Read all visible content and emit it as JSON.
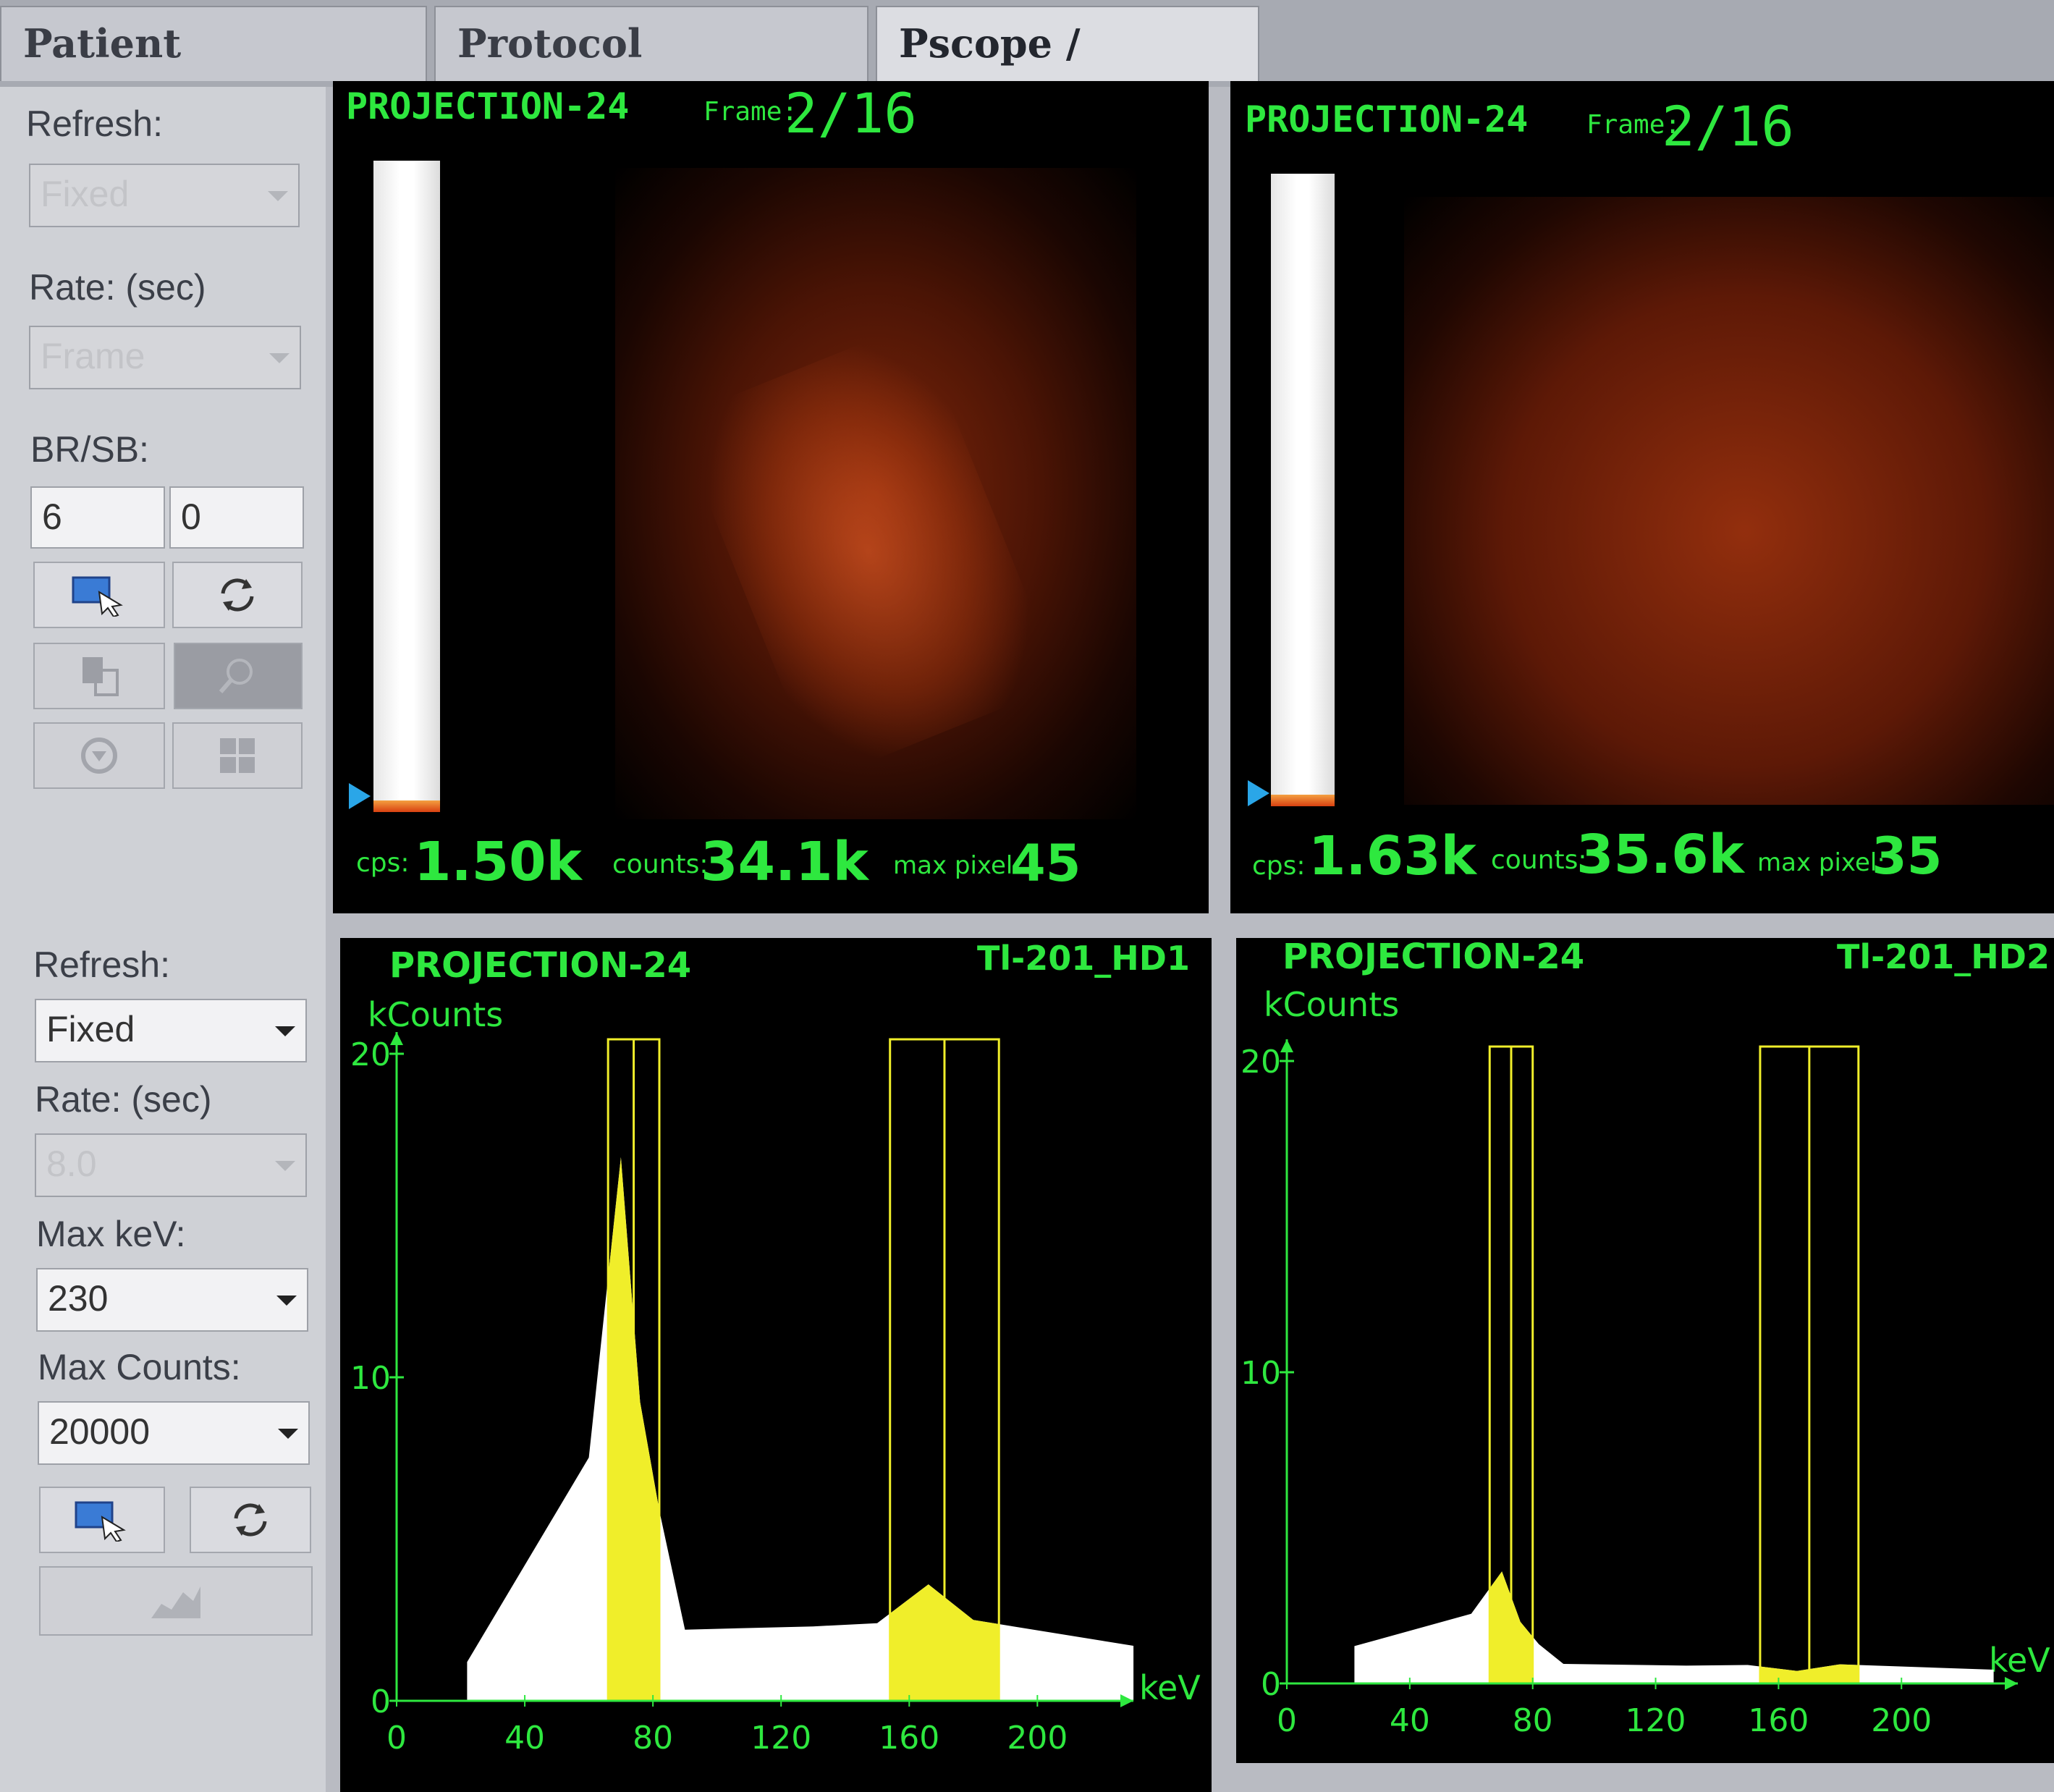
{
  "tabs": [
    {
      "label": "Patient Information"
    },
    {
      "label": "Protocol Information"
    },
    {
      "label": "Pscope / Spectrum"
    }
  ],
  "pscope_controls": {
    "refresh_label": "Refresh:",
    "refresh_value": "Fixed",
    "rate_label": "Rate: (sec)",
    "rate_value": "Frame",
    "brsb_label": "BR/SB:",
    "br_value": "6",
    "sb_value": "0"
  },
  "spectrum_controls": {
    "refresh_label": "Refresh:",
    "refresh_value": "Fixed",
    "rate_label": "Rate: (sec)",
    "rate_value": "8.0",
    "max_kev_label": "Max keV:",
    "max_kev_value": "230",
    "max_counts_label": "Max Counts:",
    "max_counts_value": "20000"
  },
  "pscope": [
    {
      "title": "PROJECTION-24",
      "frame_label": "Frame:",
      "frame": "2/16",
      "cps_label": "cps:",
      "cps": "1.50k",
      "counts_label": "counts:",
      "counts": "34.1k",
      "max_pixel_label": "max pixel:",
      "max_pixel": "45"
    },
    {
      "title": "PROJECTION-24",
      "frame_label": "Frame:",
      "frame": "2/16",
      "cps_label": "cps:",
      "cps": "1.63k",
      "counts_label": "counts:",
      "counts": "35.6k",
      "max_pixel_label": "max pixel:",
      "max_pixel": "35"
    }
  ],
  "spectra": [
    {
      "title": "PROJECTION-24",
      "isotope": "Tl-201_HD1",
      "ylabel": "kCounts",
      "xlabel": "keV",
      "yticks": [
        "20",
        "10",
        "0"
      ],
      "xticks": [
        "0",
        "40",
        "80",
        "120",
        "160",
        "200"
      ],
      "windows_kev": [
        [
          66,
          82
        ],
        [
          154,
          188
        ]
      ],
      "peak_kcounts": 16.8,
      "second_peak_kcounts": 3.6
    },
    {
      "title": "PROJECTION-24",
      "isotope": "Tl-201_HD2",
      "ylabel": "kCounts",
      "xlabel": "keV",
      "yticks": [
        "20",
        "10",
        "0"
      ],
      "xticks": [
        "0",
        "40",
        "80",
        "120",
        "160",
        "200"
      ],
      "windows_kev": [
        [
          66,
          80
        ],
        [
          154,
          186
        ]
      ],
      "peak_kcounts": 3.6,
      "second_peak_kcounts": 0.4
    }
  ],
  "colors": {
    "overlay_text": "#2ee83f",
    "energy_window": "#f0ee2a",
    "spectrum_fill": "#ffffff",
    "image_hot": "#e0501a"
  }
}
